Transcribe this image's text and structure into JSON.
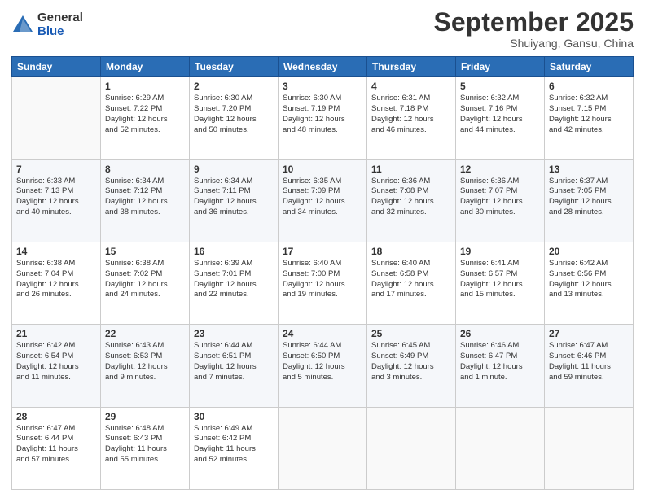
{
  "logo": {
    "general": "General",
    "blue": "Blue"
  },
  "title": "September 2025",
  "location": "Shuiyang, Gansu, China",
  "weekdays": [
    "Sunday",
    "Monday",
    "Tuesday",
    "Wednesday",
    "Thursday",
    "Friday",
    "Saturday"
  ],
  "weeks": [
    [
      {
        "day": "",
        "info": ""
      },
      {
        "day": "1",
        "info": "Sunrise: 6:29 AM\nSunset: 7:22 PM\nDaylight: 12 hours\nand 52 minutes."
      },
      {
        "day": "2",
        "info": "Sunrise: 6:30 AM\nSunset: 7:20 PM\nDaylight: 12 hours\nand 50 minutes."
      },
      {
        "day": "3",
        "info": "Sunrise: 6:30 AM\nSunset: 7:19 PM\nDaylight: 12 hours\nand 48 minutes."
      },
      {
        "day": "4",
        "info": "Sunrise: 6:31 AM\nSunset: 7:18 PM\nDaylight: 12 hours\nand 46 minutes."
      },
      {
        "day": "5",
        "info": "Sunrise: 6:32 AM\nSunset: 7:16 PM\nDaylight: 12 hours\nand 44 minutes."
      },
      {
        "day": "6",
        "info": "Sunrise: 6:32 AM\nSunset: 7:15 PM\nDaylight: 12 hours\nand 42 minutes."
      }
    ],
    [
      {
        "day": "7",
        "info": "Sunrise: 6:33 AM\nSunset: 7:13 PM\nDaylight: 12 hours\nand 40 minutes."
      },
      {
        "day": "8",
        "info": "Sunrise: 6:34 AM\nSunset: 7:12 PM\nDaylight: 12 hours\nand 38 minutes."
      },
      {
        "day": "9",
        "info": "Sunrise: 6:34 AM\nSunset: 7:11 PM\nDaylight: 12 hours\nand 36 minutes."
      },
      {
        "day": "10",
        "info": "Sunrise: 6:35 AM\nSunset: 7:09 PM\nDaylight: 12 hours\nand 34 minutes."
      },
      {
        "day": "11",
        "info": "Sunrise: 6:36 AM\nSunset: 7:08 PM\nDaylight: 12 hours\nand 32 minutes."
      },
      {
        "day": "12",
        "info": "Sunrise: 6:36 AM\nSunset: 7:07 PM\nDaylight: 12 hours\nand 30 minutes."
      },
      {
        "day": "13",
        "info": "Sunrise: 6:37 AM\nSunset: 7:05 PM\nDaylight: 12 hours\nand 28 minutes."
      }
    ],
    [
      {
        "day": "14",
        "info": "Sunrise: 6:38 AM\nSunset: 7:04 PM\nDaylight: 12 hours\nand 26 minutes."
      },
      {
        "day": "15",
        "info": "Sunrise: 6:38 AM\nSunset: 7:02 PM\nDaylight: 12 hours\nand 24 minutes."
      },
      {
        "day": "16",
        "info": "Sunrise: 6:39 AM\nSunset: 7:01 PM\nDaylight: 12 hours\nand 22 minutes."
      },
      {
        "day": "17",
        "info": "Sunrise: 6:40 AM\nSunset: 7:00 PM\nDaylight: 12 hours\nand 19 minutes."
      },
      {
        "day": "18",
        "info": "Sunrise: 6:40 AM\nSunset: 6:58 PM\nDaylight: 12 hours\nand 17 minutes."
      },
      {
        "day": "19",
        "info": "Sunrise: 6:41 AM\nSunset: 6:57 PM\nDaylight: 12 hours\nand 15 minutes."
      },
      {
        "day": "20",
        "info": "Sunrise: 6:42 AM\nSunset: 6:56 PM\nDaylight: 12 hours\nand 13 minutes."
      }
    ],
    [
      {
        "day": "21",
        "info": "Sunrise: 6:42 AM\nSunset: 6:54 PM\nDaylight: 12 hours\nand 11 minutes."
      },
      {
        "day": "22",
        "info": "Sunrise: 6:43 AM\nSunset: 6:53 PM\nDaylight: 12 hours\nand 9 minutes."
      },
      {
        "day": "23",
        "info": "Sunrise: 6:44 AM\nSunset: 6:51 PM\nDaylight: 12 hours\nand 7 minutes."
      },
      {
        "day": "24",
        "info": "Sunrise: 6:44 AM\nSunset: 6:50 PM\nDaylight: 12 hours\nand 5 minutes."
      },
      {
        "day": "25",
        "info": "Sunrise: 6:45 AM\nSunset: 6:49 PM\nDaylight: 12 hours\nand 3 minutes."
      },
      {
        "day": "26",
        "info": "Sunrise: 6:46 AM\nSunset: 6:47 PM\nDaylight: 12 hours\nand 1 minute."
      },
      {
        "day": "27",
        "info": "Sunrise: 6:47 AM\nSunset: 6:46 PM\nDaylight: 11 hours\nand 59 minutes."
      }
    ],
    [
      {
        "day": "28",
        "info": "Sunrise: 6:47 AM\nSunset: 6:44 PM\nDaylight: 11 hours\nand 57 minutes."
      },
      {
        "day": "29",
        "info": "Sunrise: 6:48 AM\nSunset: 6:43 PM\nDaylight: 11 hours\nand 55 minutes."
      },
      {
        "day": "30",
        "info": "Sunrise: 6:49 AM\nSunset: 6:42 PM\nDaylight: 11 hours\nand 52 minutes."
      },
      {
        "day": "",
        "info": ""
      },
      {
        "day": "",
        "info": ""
      },
      {
        "day": "",
        "info": ""
      },
      {
        "day": "",
        "info": ""
      }
    ]
  ]
}
